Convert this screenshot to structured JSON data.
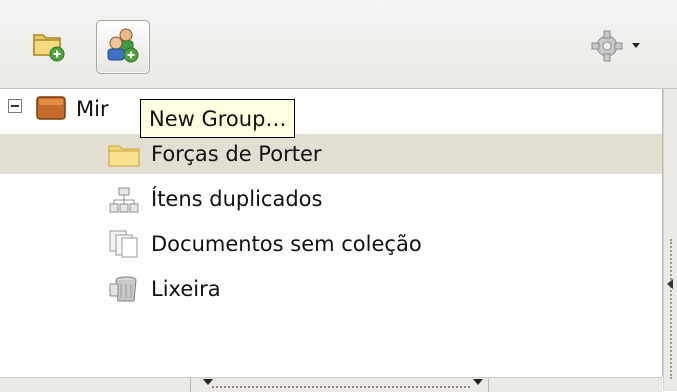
{
  "toolbar": {
    "buttons": [
      {
        "icon": "new-collection-icon"
      },
      {
        "icon": "new-group-icon"
      },
      {
        "icon": "actions-gear-icon"
      }
    ]
  },
  "tree": {
    "root": {
      "label": "Mir",
      "icon": "library-icon",
      "expanded": true
    },
    "items": [
      {
        "label": "Forças de Porter",
        "icon": "folder-icon",
        "selected": true
      },
      {
        "label": "Ítens duplicados",
        "icon": "duplicate-items-icon"
      },
      {
        "label": "Documentos sem coleção",
        "icon": "unfiled-items-icon"
      },
      {
        "label": "Lixeira",
        "icon": "trash-icon"
      }
    ]
  },
  "tooltip": {
    "text": "New Group…"
  },
  "colors": {
    "selection": "#e3ded2",
    "tooltip_bg": "#ffffe1",
    "toolbar_bg": "#eceae6"
  }
}
